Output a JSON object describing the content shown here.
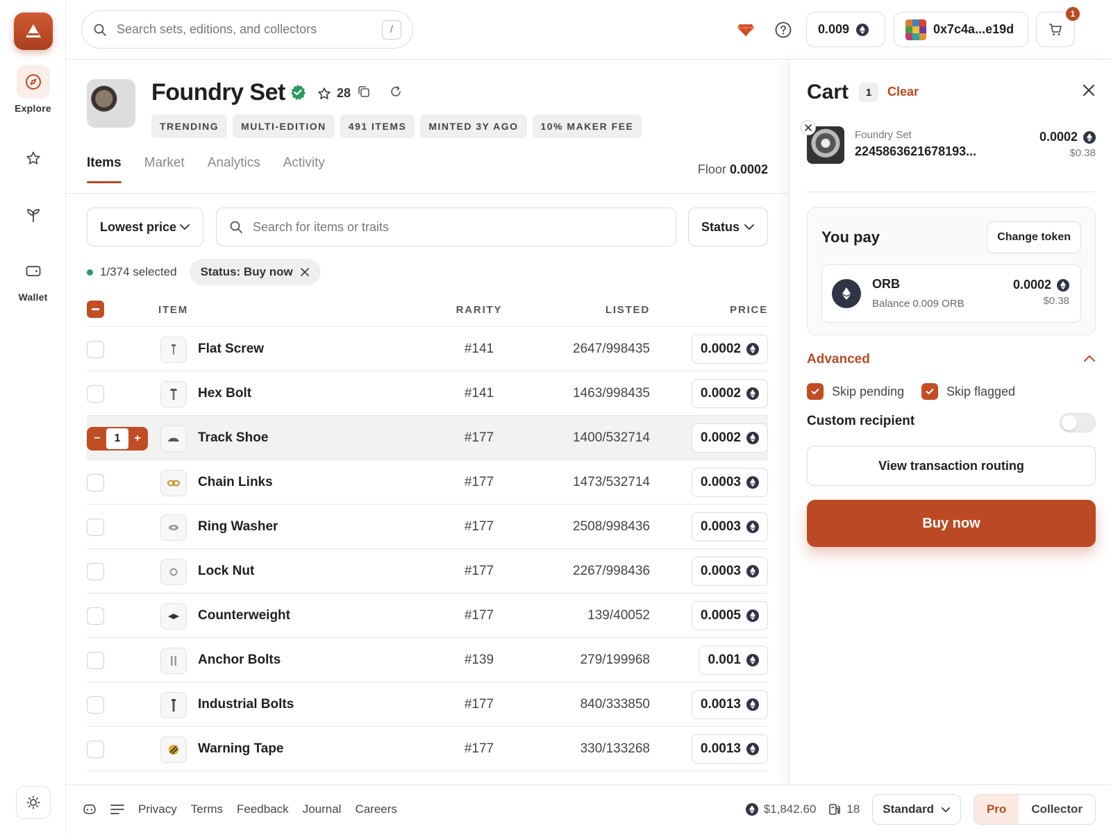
{
  "nav": {
    "items": [
      {
        "label": "Explore",
        "icon": "compass-icon"
      },
      {
        "label": "",
        "icon": "star-icon"
      },
      {
        "label": "",
        "icon": "sprout-icon"
      },
      {
        "label": "Wallet",
        "icon": "wallet-icon"
      }
    ]
  },
  "topbar": {
    "search_placeholder": "Search sets, editions, and collectors",
    "search_shortcut": "/",
    "balance": "0.009",
    "wallet_address": "0x7c4a...e19d",
    "cart_badge": "1"
  },
  "collection": {
    "title": "Foundry Set",
    "stars": "28",
    "tags": [
      "TRENDING",
      "MULTI-EDITION",
      "491 ITEMS",
      "MINTED 3Y AGO",
      "10% MAKER FEE"
    ],
    "tabs": [
      "Items",
      "Market",
      "Analytics",
      "Activity"
    ],
    "floor_label": "Floor",
    "floor_value": "0.0002"
  },
  "filters": {
    "sort": "Lowest price",
    "search_placeholder": "Search for items or traits",
    "status": "Status",
    "selected_text": "1/374 selected",
    "active_chip": "Status: Buy now"
  },
  "table": {
    "headers": {
      "item": "ITEM",
      "rarity": "RARITY",
      "listed": "LISTED",
      "price": "PRICE"
    },
    "rows": [
      {
        "name": "Flat Screw",
        "rarity": "#141",
        "listed": "2647/998435",
        "price": "0.0002",
        "selected": false
      },
      {
        "name": "Hex Bolt",
        "rarity": "#141",
        "listed": "1463/998435",
        "price": "0.0002",
        "selected": false
      },
      {
        "name": "Track Shoe",
        "rarity": "#177",
        "listed": "1400/532714",
        "price": "0.0002",
        "selected": true,
        "qty": "1"
      },
      {
        "name": "Chain Links",
        "rarity": "#177",
        "listed": "1473/532714",
        "price": "0.0003",
        "selected": false
      },
      {
        "name": "Ring Washer",
        "rarity": "#177",
        "listed": "2508/998436",
        "price": "0.0003",
        "selected": false
      },
      {
        "name": "Lock Nut",
        "rarity": "#177",
        "listed": "2267/998436",
        "price": "0.0003",
        "selected": false
      },
      {
        "name": "Counterweight",
        "rarity": "#177",
        "listed": "139/40052",
        "price": "0.0005",
        "selected": false
      },
      {
        "name": "Anchor Bolts",
        "rarity": "#139",
        "listed": "279/199968",
        "price": "0.001",
        "selected": false
      },
      {
        "name": "Industrial Bolts",
        "rarity": "#177",
        "listed": "840/333850",
        "price": "0.0013",
        "selected": false
      },
      {
        "name": "Warning Tape",
        "rarity": "#177",
        "listed": "330/133268",
        "price": "0.0013",
        "selected": false
      }
    ]
  },
  "footer": {
    "links": [
      "Privacy",
      "Terms",
      "Feedback",
      "Journal",
      "Careers"
    ],
    "eth_price": "$1,842.60",
    "gas": "18",
    "mode": "Standard",
    "seg_pro": "Pro",
    "seg_collector": "Collector"
  },
  "cart": {
    "title": "Cart",
    "count": "1",
    "clear": "Clear",
    "item_set": "Foundry Set",
    "item_name": "2245863621678193...",
    "item_price": "0.0002",
    "item_usd": "$0.38",
    "you_pay": "You pay",
    "change_token": "Change token",
    "token": "ORB",
    "token_balance": "Balance 0.009 ORB",
    "token_amount": "0.0002",
    "token_usd": "$0.38",
    "advanced": "Advanced",
    "skip_pending": "Skip pending",
    "skip_flagged": "Skip flagged",
    "custom_recipient": "Custom recipient",
    "routing": "View transaction routing",
    "buy_now": "Buy now"
  },
  "colors": {
    "accent": "#bb4a24",
    "verified": "#2e9a5f",
    "token": "#2f3545"
  }
}
